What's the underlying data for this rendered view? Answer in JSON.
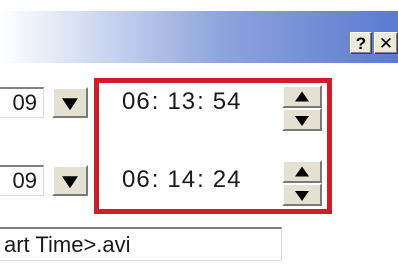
{
  "titlebar": {
    "help_label": "?",
    "close_label": "✕"
  },
  "start": {
    "date_value": "09",
    "time": {
      "hour": "06",
      "minute": "13",
      "second": "54",
      "separator": ":"
    }
  },
  "end": {
    "date_value": "09",
    "time": {
      "hour": "06",
      "minute": "14",
      "second": "24",
      "separator": ":"
    }
  },
  "filename": {
    "value": "art Time>.avi"
  },
  "icons": {
    "date_dropdown": "chevron-down-icon",
    "spin_up": "arrow-up-icon",
    "spin_down": "arrow-down-icon"
  },
  "colors": {
    "highlight": "#cc1f2a",
    "titlebar_end": "#5b7ad0",
    "button_face": "#e4e0d2"
  }
}
